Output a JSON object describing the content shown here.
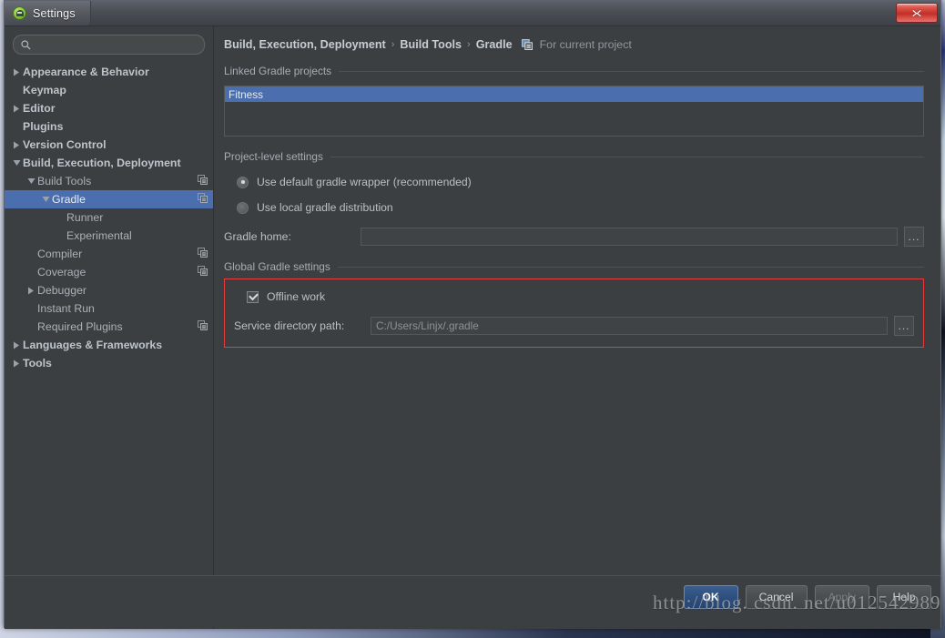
{
  "window": {
    "title": "Settings",
    "app_icon": "android-studio-icon",
    "close_label": "x"
  },
  "search": {
    "placeholder": "",
    "value": "",
    "icon": "search-icon"
  },
  "sidebar": {
    "items": [
      {
        "label": "Appearance & Behavior",
        "indent": 0,
        "twisty": "collapsed",
        "bold": true,
        "selected": false,
        "scope_icon": false
      },
      {
        "label": "Keymap",
        "indent": 0,
        "twisty": "none",
        "bold": true,
        "selected": false,
        "scope_icon": false
      },
      {
        "label": "Editor",
        "indent": 0,
        "twisty": "collapsed",
        "bold": true,
        "selected": false,
        "scope_icon": false
      },
      {
        "label": "Plugins",
        "indent": 0,
        "twisty": "none",
        "bold": true,
        "selected": false,
        "scope_icon": false
      },
      {
        "label": "Version Control",
        "indent": 0,
        "twisty": "collapsed",
        "bold": true,
        "selected": false,
        "scope_icon": false
      },
      {
        "label": "Build, Execution, Deployment",
        "indent": 0,
        "twisty": "expanded",
        "bold": true,
        "selected": false,
        "scope_icon": false
      },
      {
        "label": "Build Tools",
        "indent": 1,
        "twisty": "expanded",
        "bold": false,
        "selected": false,
        "scope_icon": true
      },
      {
        "label": "Gradle",
        "indent": 2,
        "twisty": "expanded",
        "bold": false,
        "selected": true,
        "scope_icon": true
      },
      {
        "label": "Runner",
        "indent": 3,
        "twisty": "none",
        "bold": false,
        "selected": false,
        "scope_icon": false
      },
      {
        "label": "Experimental",
        "indent": 3,
        "twisty": "none",
        "bold": false,
        "selected": false,
        "scope_icon": false
      },
      {
        "label": "Compiler",
        "indent": 1,
        "twisty": "none",
        "bold": false,
        "selected": false,
        "scope_icon": true
      },
      {
        "label": "Coverage",
        "indent": 1,
        "twisty": "none",
        "bold": false,
        "selected": false,
        "scope_icon": true
      },
      {
        "label": "Debugger",
        "indent": 1,
        "twisty": "collapsed",
        "bold": false,
        "selected": false,
        "scope_icon": false
      },
      {
        "label": "Instant Run",
        "indent": 1,
        "twisty": "none",
        "bold": false,
        "selected": false,
        "scope_icon": false
      },
      {
        "label": "Required Plugins",
        "indent": 1,
        "twisty": "none",
        "bold": false,
        "selected": false,
        "scope_icon": true
      },
      {
        "label": "Languages & Frameworks",
        "indent": 0,
        "twisty": "collapsed",
        "bold": true,
        "selected": false,
        "scope_icon": false
      },
      {
        "label": "Tools",
        "indent": 0,
        "twisty": "collapsed",
        "bold": true,
        "selected": false,
        "scope_icon": false
      }
    ]
  },
  "breadcrumb": {
    "parts": [
      "Build, Execution, Deployment",
      "Build Tools",
      "Gradle"
    ],
    "separator": "›",
    "scope_icon": "project-scope-icon",
    "note": "For current project"
  },
  "linked_projects": {
    "group_label": "Linked Gradle projects",
    "items": [
      {
        "label": "Fitness",
        "selected": true
      }
    ]
  },
  "project_level": {
    "group_label": "Project-level settings",
    "radios": [
      {
        "label": "Use default gradle wrapper (recommended)",
        "checked": true
      },
      {
        "label": "Use local gradle distribution",
        "checked": false
      }
    ],
    "gradle_home": {
      "label": "Gradle home:",
      "value": "",
      "placeholder": "",
      "browse_label": "..."
    }
  },
  "global_settings": {
    "group_label": "Global Gradle settings",
    "highlight_color": "#e83b3b",
    "offline_work": {
      "label": "Offline work",
      "checked": true
    },
    "service_dir": {
      "label": "Service directory path:",
      "value": "C:/Users/Linjx/.gradle",
      "browse_label": "..."
    }
  },
  "footer": {
    "buttons": [
      {
        "label": "OK",
        "style": "primary"
      },
      {
        "label": "Cancel",
        "style": "normal"
      },
      {
        "label": "Apply",
        "style": "disabled"
      },
      {
        "label": "Help",
        "style": "normal"
      }
    ]
  },
  "watermark": {
    "text": "http://blog. csdn. net/u012542989"
  },
  "colors": {
    "accent_selection": "#4b6eaf",
    "window_bg": "#3c3f41",
    "highlight": "#e83b3b",
    "primary_button": "#2f5180"
  }
}
